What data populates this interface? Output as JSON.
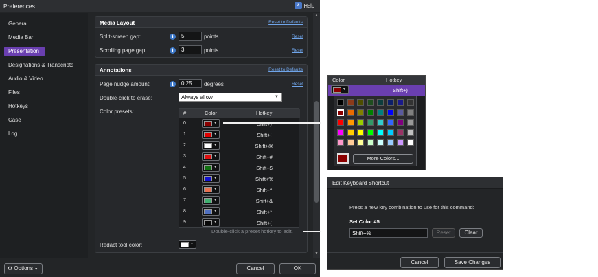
{
  "window": {
    "title": "Preferences",
    "help_label": "Help"
  },
  "sidebar": {
    "items": [
      {
        "label": "General"
      },
      {
        "label": "Media Bar"
      },
      {
        "label": "Presentation",
        "active": true
      },
      {
        "label": "Designations & Transcripts"
      },
      {
        "label": "Audio & Video"
      },
      {
        "label": "Files"
      },
      {
        "label": "Hotkeys"
      },
      {
        "label": "Case"
      },
      {
        "label": "Log"
      }
    ]
  },
  "media_layout": {
    "title": "Media Layout",
    "reset_defaults": "Reset to Defaults",
    "split_label": "Split-screen gap:",
    "split_value": "5",
    "split_unit": "points",
    "scroll_label": "Scrolling page gap:",
    "scroll_value": "3",
    "scroll_unit": "points",
    "reset": "Reset"
  },
  "annotations": {
    "title": "Annotations",
    "reset_defaults": "Reset to Defaults",
    "nudge_label": "Page nudge amount:",
    "nudge_value": "0.25",
    "nudge_unit": "degrees",
    "reset": "Reset",
    "erase_label": "Double-click to erase:",
    "erase_value": "Always allow",
    "presets_label": "Color presets:",
    "table_headers": {
      "num": "#",
      "color": "Color",
      "hotkey": "Hotkey"
    },
    "presets": [
      {
        "num": "0",
        "color": "#8b0000",
        "hotkey": "Shift+)"
      },
      {
        "num": "1",
        "color": "#e00000",
        "hotkey": "Shift+!"
      },
      {
        "num": "2",
        "color": "#ffffff",
        "hotkey": "Shift+@"
      },
      {
        "num": "3",
        "color": "#e01010",
        "hotkey": "Shift+#"
      },
      {
        "num": "4",
        "color": "#107010",
        "hotkey": "Shift+$"
      },
      {
        "num": "5",
        "color": "#1010d0",
        "hotkey": "Shift+%"
      },
      {
        "num": "6",
        "color": "#e87050",
        "hotkey": "Shift+^"
      },
      {
        "num": "7",
        "color": "#40b070",
        "hotkey": "Shift+&"
      },
      {
        "num": "8",
        "color": "#5070c0",
        "hotkey": "Shift+*"
      },
      {
        "num": "9",
        "color": "#080808",
        "hotkey": "Shift+("
      }
    ],
    "table_hint": "Double-click a preset hotkey to edit.",
    "redact_label": "Redact tool color:",
    "redact_color": "#ffffff"
  },
  "footer": {
    "options": "Options",
    "cancel": "Cancel",
    "ok": "OK"
  },
  "color_popup": {
    "header_color": "Color",
    "header_hotkey": "Hotkey",
    "selected_hotkey": "Shift+)",
    "selected_color": "#8b0000",
    "palette": [
      [
        "#000000",
        "#8b3a1a",
        "#4d4d00",
        "#1f4d1f",
        "#0d3d3d",
        "#0d1f6b",
        "#1a1a8b",
        "#333333"
      ],
      [
        "#8b0000",
        "#e86a00",
        "#808000",
        "#008000",
        "#008080",
        "#0000ff",
        "#5a5aa0",
        "#808080"
      ],
      [
        "#ff0000",
        "#ff9900",
        "#99cc00",
        "#339966",
        "#33cccc",
        "#3366ff",
        "#800080",
        "#999999"
      ],
      [
        "#ff00ff",
        "#ffcc00",
        "#ffff00",
        "#00ff00",
        "#00ffff",
        "#00ccff",
        "#993366",
        "#c0c0c0"
      ],
      [
        "#ff99cc",
        "#ffcc99",
        "#ffff99",
        "#ccffcc",
        "#ccffff",
        "#99ccff",
        "#cc99ff",
        "#ffffff"
      ]
    ],
    "more_colors": "More Colors..."
  },
  "shortcut_dialog": {
    "title": "Edit Keyboard Shortcut",
    "prompt": "Press a new key combination to use for this command:",
    "command_label": "Set Color #5:",
    "value": "Shift+%",
    "reset": "Reset",
    "clear": "Clear",
    "cancel": "Cancel",
    "save": "Save Changes"
  }
}
